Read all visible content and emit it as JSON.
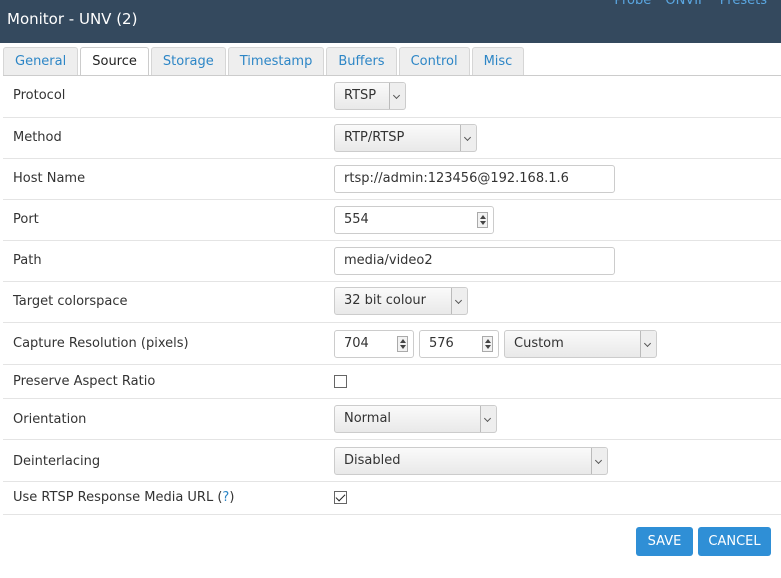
{
  "header": {
    "title": "Monitor - UNV (2)",
    "links": [
      "Probe",
      "ONVIF",
      "Presets"
    ]
  },
  "tabs": [
    "General",
    "Source",
    "Storage",
    "Timestamp",
    "Buffers",
    "Control",
    "Misc"
  ],
  "active_tab": "Source",
  "fields": {
    "protocol": {
      "label": "Protocol",
      "value": "RTSP"
    },
    "method": {
      "label": "Method",
      "value": "RTP/RTSP"
    },
    "host_name": {
      "label": "Host Name",
      "value": "rtsp://admin:123456@192.168.1.6"
    },
    "port": {
      "label": "Port",
      "value": "554"
    },
    "path": {
      "label": "Path",
      "value": "media/video2"
    },
    "target_colorspace": {
      "label": "Target colorspace",
      "value": "32 bit colour"
    },
    "capture_resolution": {
      "label": "Capture Resolution (pixels)",
      "width": "704",
      "height": "576",
      "preset": "Custom"
    },
    "preserve_aspect_ratio": {
      "label": "Preserve Aspect Ratio",
      "checked": false
    },
    "orientation": {
      "label": "Orientation",
      "value": "Normal"
    },
    "deinterlacing": {
      "label": "Deinterlacing",
      "value": "Disabled"
    },
    "use_rtsp_response_media_url": {
      "label": "Use RTSP Response Media URL (",
      "help": "?",
      "label_end": ")",
      "checked": true
    }
  },
  "buttons": {
    "save": "SAVE",
    "cancel": "CANCEL"
  },
  "colors": {
    "header_bg": "#34495e",
    "accent": "#2f8fd6",
    "link": "#2d86c6"
  }
}
